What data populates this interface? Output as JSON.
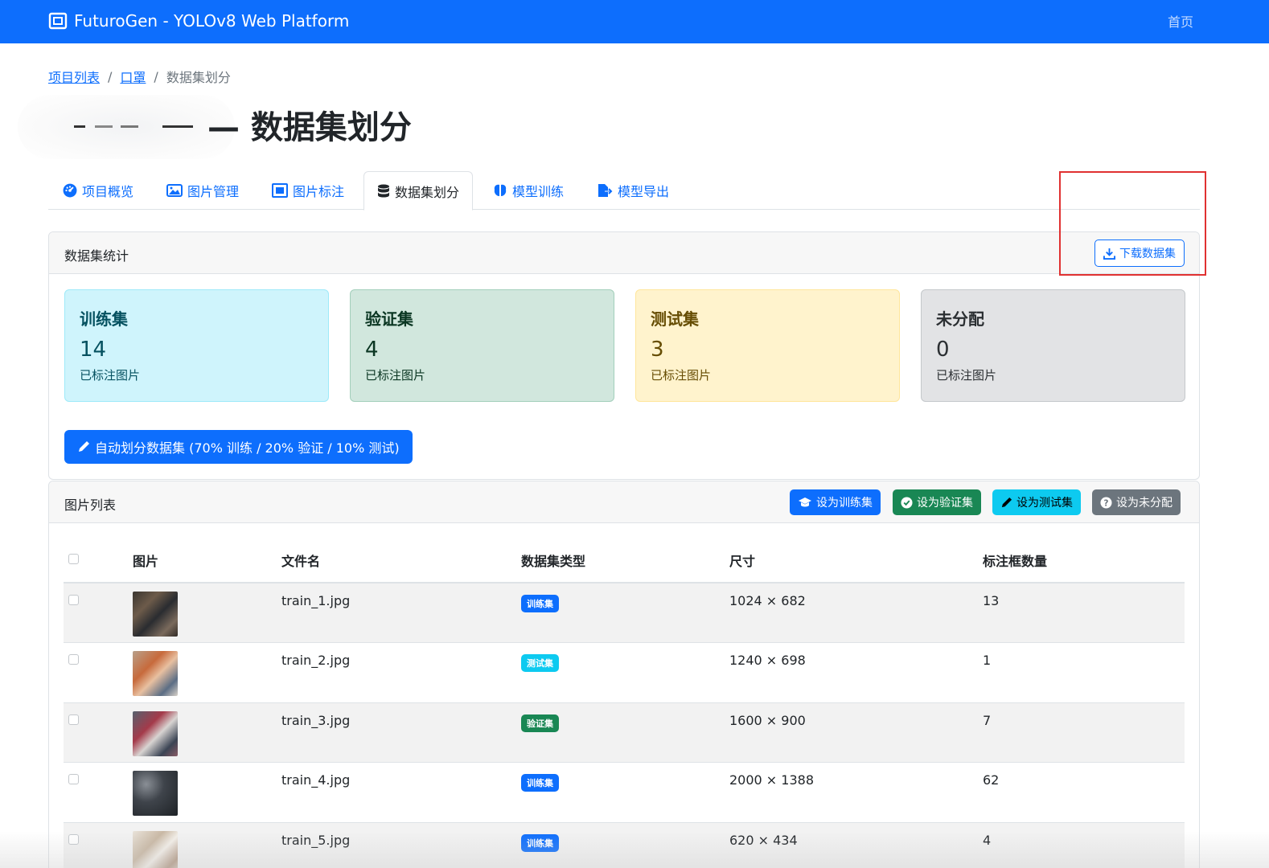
{
  "navbar": {
    "brand": "FuturoGen - YOLOv8 Web Platform",
    "home_link": "首页",
    "brand_color": "#0d6efd"
  },
  "breadcrumb": {
    "items": [
      "项目列表",
      "口罩"
    ],
    "current": "数据集划分"
  },
  "page": {
    "title": "— 数据集划分"
  },
  "tabs": [
    {
      "label": "项目概览",
      "icon": "dashboard-icon"
    },
    {
      "label": "图片管理",
      "icon": "images-icon"
    },
    {
      "label": "图片标注",
      "icon": "annotation-icon"
    },
    {
      "label": "数据集划分",
      "icon": "database-icon",
      "active": true
    },
    {
      "label": "模型训练",
      "icon": "brain-icon"
    },
    {
      "label": "模型导出",
      "icon": "export-icon"
    }
  ],
  "stats_card": {
    "title": "数据集统计",
    "download_label": "下载数据集",
    "stats": [
      {
        "title": "训练集",
        "count": "14",
        "sub": "已标注图片",
        "bg": "#cff4fc",
        "border": "#9eeaf9",
        "color": "#055160"
      },
      {
        "title": "验证集",
        "count": "4",
        "sub": "已标注图片",
        "bg": "#d1e7dd",
        "border": "#a3cfbb",
        "color": "#0a3622"
      },
      {
        "title": "测试集",
        "count": "3",
        "sub": "已标注图片",
        "bg": "#fff3cd",
        "border": "#ffe69c",
        "color": "#664d03"
      },
      {
        "title": "未分配",
        "count": "0",
        "sub": "已标注图片",
        "bg": "#e2e3e5",
        "border": "#c4c8cb",
        "color": "#2b2f32"
      }
    ],
    "auto_split_label": "自动划分数据集 (70% 训练 / 20% 验证 / 10% 测试)"
  },
  "image_card": {
    "title": "图片列表",
    "actions": [
      {
        "label": "设为训练集",
        "color": "#0d6efd",
        "icon": "graduation-cap-icon"
      },
      {
        "label": "设为验证集",
        "color": "#198754",
        "icon": "check-circle-icon"
      },
      {
        "label": "设为测试集",
        "color": "#0dcaf0",
        "icon": "pencil-icon"
      },
      {
        "label": "设为未分配",
        "color": "#6c757d",
        "icon": "question-circle-icon"
      }
    ],
    "columns": [
      "图片",
      "文件名",
      "数据集类型",
      "尺寸",
      "标注框数量"
    ],
    "rows": [
      {
        "filename": "train_1.jpg",
        "type": "训练集",
        "type_color": "#0d6efd",
        "size": "1024 × 682",
        "boxes": "13"
      },
      {
        "filename": "train_2.jpg",
        "type": "测试集",
        "type_color": "#0dcaf0",
        "size": "1240 × 698",
        "boxes": "1"
      },
      {
        "filename": "train_3.jpg",
        "type": "验证集",
        "type_color": "#198754",
        "size": "1600 × 900",
        "boxes": "7"
      },
      {
        "filename": "train_4.jpg",
        "type": "训练集",
        "type_color": "#0d6efd",
        "size": "2000 × 1388",
        "boxes": "62"
      },
      {
        "filename": "train_5.jpg",
        "type": "训练集",
        "type_color": "#0d6efd",
        "size": "620 × 434",
        "boxes": "4"
      }
    ]
  }
}
